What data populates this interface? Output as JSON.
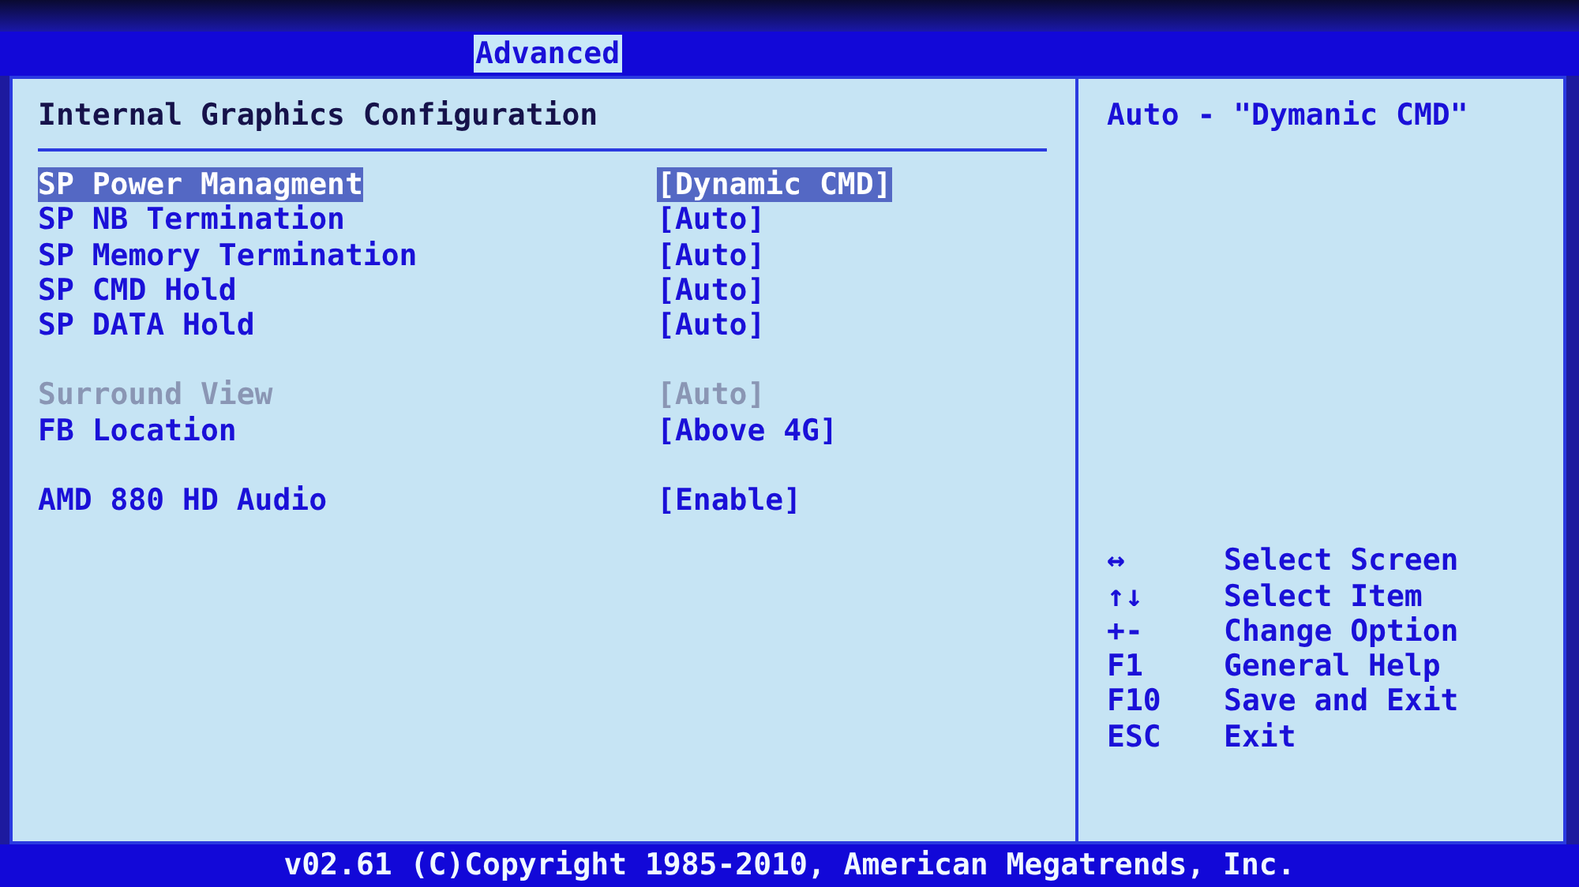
{
  "tabs": [
    {
      "label": "Advanced",
      "selected": true
    }
  ],
  "page_title": "Internal Graphics Configuration",
  "groups": [
    {
      "items": [
        {
          "label": "SP Power Managment",
          "value": "[Dynamic CMD]",
          "selected": true,
          "disabled": false
        },
        {
          "label": "SP NB Termination",
          "value": "[Auto]",
          "selected": false,
          "disabled": false
        },
        {
          "label": "SP Memory Termination",
          "value": "[Auto]",
          "selected": false,
          "disabled": false
        },
        {
          "label": "SP CMD Hold",
          "value": "[Auto]",
          "selected": false,
          "disabled": false
        },
        {
          "label": "SP DATA Hold",
          "value": "[Auto]",
          "selected": false,
          "disabled": false
        }
      ]
    },
    {
      "items": [
        {
          "label": "Surround View",
          "value": "[Auto]",
          "selected": false,
          "disabled": true
        },
        {
          "label": "FB Location",
          "value": "[Above 4G]",
          "selected": false,
          "disabled": false
        }
      ]
    },
    {
      "items": [
        {
          "label": "AMD 880 HD Audio",
          "value": "[Enable]",
          "selected": false,
          "disabled": false
        }
      ]
    }
  ],
  "help_text": "Auto - \"Dymanic CMD\"",
  "keys": [
    {
      "key": "↔",
      "action": "Select Screen"
    },
    {
      "key": "↑↓",
      "action": "Select Item"
    },
    {
      "key": "+-",
      "action": "Change Option"
    },
    {
      "key": "F1",
      "action": "General Help"
    },
    {
      "key": "F10",
      "action": "Save and Exit"
    },
    {
      "key": "ESC",
      "action": "Exit"
    }
  ],
  "status_bar": "v02.61 (C)Copyright 1985-2010, American Megatrends, Inc."
}
